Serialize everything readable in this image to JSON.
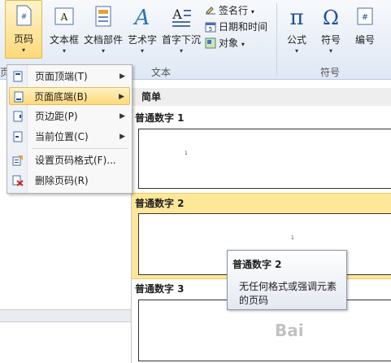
{
  "ribbon": {
    "page_number": "页码",
    "textbox": "文本框",
    "quick_parts": "文档部件",
    "wordart": "艺术字",
    "dropcap": "首字下沉",
    "signature_line": "签名行",
    "date_time": "日期和时间",
    "object": "对象",
    "equation": "公式",
    "symbol": "符号",
    "number": "编号",
    "group_text": "文本",
    "group_symbols": "符号",
    "group_header_footer_partial": "页",
    "chevron": "▾"
  },
  "menu": {
    "items": [
      {
        "label": "页面顶端(T)",
        "icon": "page-top-icon",
        "has_submenu": true
      },
      {
        "label": "页面底端(B)",
        "icon": "page-bottom-icon",
        "has_submenu": true
      },
      {
        "label": "页边距(P)",
        "icon": "page-margin-icon",
        "has_submenu": true
      },
      {
        "label": "当前位置(C)",
        "icon": "current-position-icon",
        "has_submenu": true
      },
      {
        "label": "设置页码格式(F)...",
        "icon": "format-page-numbers-icon",
        "has_submenu": false
      },
      {
        "label": "删除页码(R)",
        "icon": "remove-page-numbers-icon",
        "has_submenu": false
      }
    ],
    "arrow": "▶"
  },
  "gallery": {
    "header": "简单",
    "options": [
      {
        "title": "普通数字 1",
        "number": "1"
      },
      {
        "title": "普通数字 2",
        "number": "1"
      },
      {
        "title": "普通数字 3",
        "number": ""
      }
    ]
  },
  "tooltip": {
    "title": "普通数字 2",
    "body": "无任何格式或强调元素的页码"
  },
  "watermark": "Bai",
  "colors": {
    "highlight": "#fde89a",
    "ribbon": "#dfe8f5",
    "accent_blue": "#1e4f9c"
  }
}
